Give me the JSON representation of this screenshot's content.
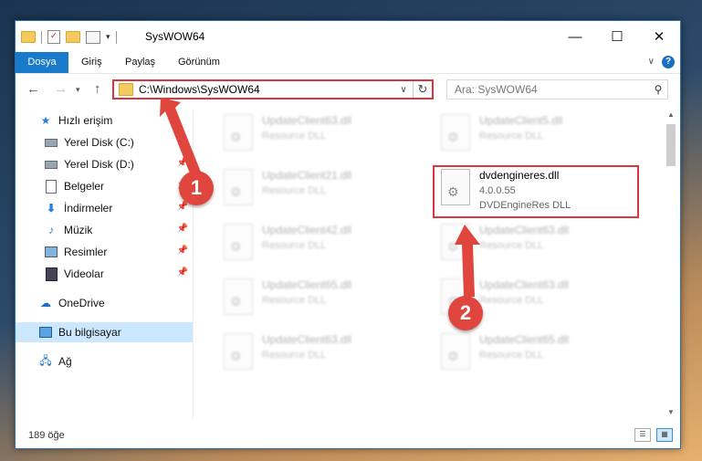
{
  "window": {
    "title": "SysWOW64",
    "controls": {
      "minimize": "—",
      "maximize": "☐",
      "close": "✕"
    }
  },
  "ribbon": {
    "tabs": [
      {
        "label": "Dosya",
        "active": true
      },
      {
        "label": "Giriş"
      },
      {
        "label": "Paylaş"
      },
      {
        "label": "Görünüm"
      }
    ],
    "help": "?"
  },
  "address": {
    "path": "C:\\Windows\\SysWOW64"
  },
  "search": {
    "placeholder": "Ara: SysWOW64"
  },
  "sidebar": {
    "items": [
      {
        "label": "Hızlı erişim",
        "icon": "star-icon"
      },
      {
        "label": "Yerel Disk (C:)",
        "icon": "drive-icon",
        "pinned": true
      },
      {
        "label": "Yerel Disk (D:)",
        "icon": "drive-icon",
        "pinned": true
      },
      {
        "label": "Belgeler",
        "icon": "documents-icon",
        "pinned": true
      },
      {
        "label": "İndirmeler",
        "icon": "downloads-icon",
        "pinned": true
      },
      {
        "label": "Müzik",
        "icon": "music-icon",
        "pinned": true
      },
      {
        "label": "Resimler",
        "icon": "pictures-icon",
        "pinned": true
      },
      {
        "label": "Videolar",
        "icon": "videos-icon",
        "pinned": true
      },
      {
        "label": "OneDrive",
        "icon": "onedrive-icon"
      },
      {
        "label": "Bu bilgisayar",
        "icon": "computer-icon",
        "selected": true
      },
      {
        "label": "Ağ",
        "icon": "network-icon"
      }
    ]
  },
  "files": [
    {
      "name": "UpdateClient63.dll",
      "type": "Resource DLL"
    },
    {
      "name": "UpdateClient5.dll",
      "type": "Resource DLL"
    },
    {
      "name": "UpdateClient21.dll",
      "type": "Resource DLL"
    },
    {
      "name": "dvdengineres.dll",
      "version": "4.0.0.55",
      "type": "DVDEngineRes DLL"
    },
    {
      "name": "UpdateClient42.dll",
      "type": "Resource DLL"
    },
    {
      "name": "UpdateClient63.dll",
      "type": "Resource DLL"
    },
    {
      "name": "UpdateClient65.dll",
      "type": "Resource DLL"
    },
    {
      "name": "UpdateClient63.dll",
      "type": "Resource DLL"
    },
    {
      "name": "UpdateClient63.dll",
      "type": "Resource DLL"
    },
    {
      "name": "UpdateClient65.dll",
      "type": "Resource DLL"
    }
  ],
  "status": {
    "count": "189 öğe"
  },
  "annotations": {
    "step1": "1",
    "step2": "2",
    "color": "#e0463e"
  }
}
